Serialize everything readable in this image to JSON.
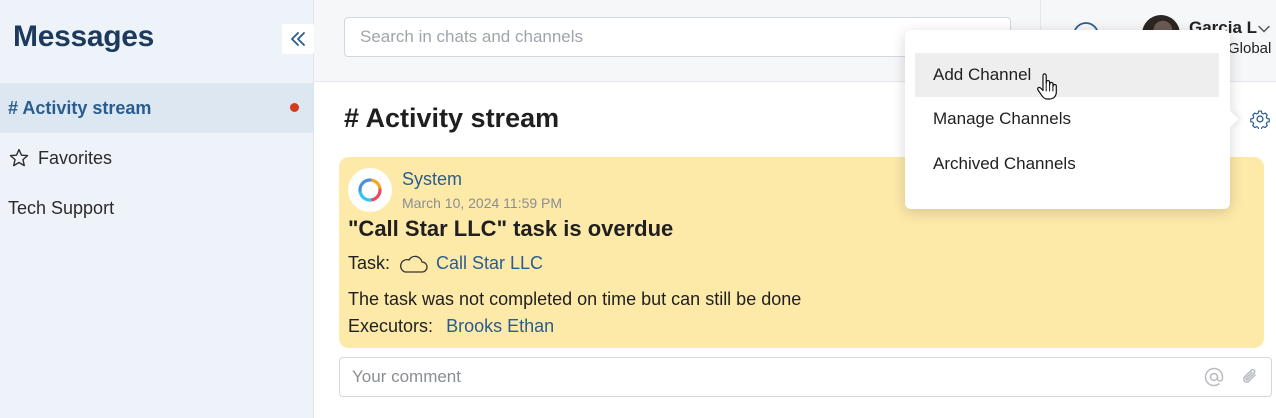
{
  "sidebar": {
    "title": "Messages",
    "items": [
      {
        "label": "# Activity stream",
        "active": true,
        "unread": true
      },
      {
        "label": "Favorites",
        "icon": "star-icon"
      },
      {
        "label": "Tech Support"
      }
    ]
  },
  "topbar": {
    "search_placeholder": "Search in chats and channels",
    "user": {
      "name": "Garcia L",
      "subtitle": "Global"
    }
  },
  "channel": {
    "title": "# Activity stream"
  },
  "message": {
    "author": "System",
    "timestamp": "March 10, 2024 11:59 PM",
    "title": "\"Call Star LLC\" task is overdue",
    "task_label": "Task:",
    "task_link": "Call Star LLC",
    "description": "The task was not completed on time but can still be done",
    "executors_label": "Executors:",
    "executor": "Brooks Ethan"
  },
  "comment": {
    "placeholder": "Your comment"
  },
  "dropdown": {
    "items": [
      {
        "label": "Add Channel",
        "hovered": true
      },
      {
        "label": "Manage Channels"
      },
      {
        "label": "Archived Channels"
      }
    ]
  },
  "colors": {
    "accent": "#2a5d8f",
    "card_bg": "#fde9a8",
    "sidebar_bg": "#eef3f9",
    "unread_dot": "#d33b1f"
  }
}
